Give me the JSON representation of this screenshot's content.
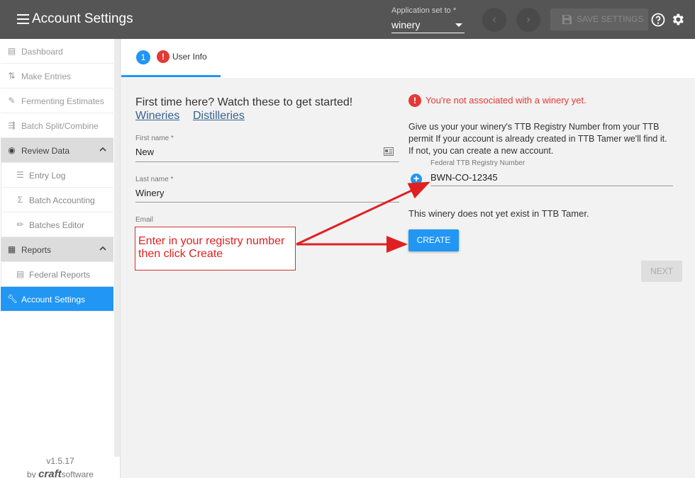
{
  "header": {
    "title": "Account Settings",
    "app_set_label": "Application set to *",
    "app_set_value": "winery",
    "save_label": "SAVE SETTINGS"
  },
  "sidebar": {
    "items": [
      {
        "label": "Dashboard",
        "icon": "clipboard-icon"
      },
      {
        "label": "Make Entries",
        "icon": "swap-vertical-icon"
      },
      {
        "label": "Fermenting Estimates",
        "icon": "edit-note-icon"
      },
      {
        "label": "Batch Split/Combine",
        "icon": "split-icon"
      },
      {
        "label": "Review Data",
        "icon": "eye-icon"
      },
      {
        "label": "Entry Log",
        "icon": "list-numbered-icon"
      },
      {
        "label": "Batch Accounting",
        "icon": "sigma-icon"
      },
      {
        "label": "Batches Editor",
        "icon": "pencil-icon"
      },
      {
        "label": "Reports",
        "icon": "document-icon"
      },
      {
        "label": "Federal Reports",
        "icon": "report-icon"
      },
      {
        "label": "Account Settings",
        "icon": "wrench-icon"
      }
    ],
    "version": "v1.5.17",
    "by": "by",
    "brand_bold": "craft",
    "brand_rest": "software"
  },
  "stepper": {
    "step_number": "1",
    "step_label": "User Info"
  },
  "form": {
    "intro": "First time here? Watch these to get started!",
    "link_wineries": "Wineries",
    "link_distilleries": "Distilleries",
    "first_name_label": "First name *",
    "first_name_value": "New",
    "last_name_label": "Last name *",
    "last_name_value": "Winery",
    "email_label": "Email"
  },
  "registry": {
    "warning": "You're not associated with a winery yet.",
    "description": "Give us your your winery's TTB Registry Number from your TTB permit If your account is already created in TTB Tamer we'll find it. If not, you can create a new account.",
    "ttb_label": "Federal TTB Registry Number",
    "ttb_value": "BWN-CO-12345",
    "not_exist": "This winery does not yet exist in TTB Tamer.",
    "create_label": "CREATE",
    "next_label": "NEXT"
  },
  "annotation": {
    "line1": "Enter in your registry number",
    "line2": "then click Create"
  },
  "colors": {
    "accent": "#2196f3",
    "error": "#e53935",
    "topbar": "#555555",
    "annotation": "#e02020"
  }
}
